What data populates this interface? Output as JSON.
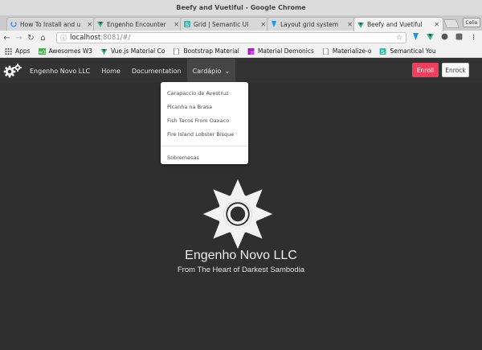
{
  "window": {
    "title": "Beefy and Vuetiful - Google Chrome"
  },
  "tabs": [
    {
      "label": "How To Install and u",
      "icon": "loading-icon"
    },
    {
      "label": "Engenho Encounter",
      "icon": "vue-icon"
    },
    {
      "label": "Grid | Semantic UI",
      "icon": "semantic-icon"
    },
    {
      "label": "Layout grid system",
      "icon": "vuetify-icon"
    },
    {
      "label": "Beefy and Vuetiful",
      "icon": "vue-icon"
    }
  ],
  "profile": {
    "label": "Celio"
  },
  "address": {
    "host": "localhost",
    "path": ":8081/#/"
  },
  "bookmarks": [
    {
      "label": "Apps",
      "icon": "apps-icon"
    },
    {
      "label": "Awesomes W3",
      "icon": "w3-icon"
    },
    {
      "label": "Vue.js Material Co",
      "icon": "vue-icon"
    },
    {
      "label": "Bootstrap Material",
      "icon": "page-icon"
    },
    {
      "label": "Material Demonics",
      "icon": "material-icon"
    },
    {
      "label": "Materialize-o",
      "icon": "page-icon"
    },
    {
      "label": "Semantical You",
      "icon": "semantic-icon"
    }
  ],
  "navbar": {
    "brand": "Engenho Novo LLC",
    "items": [
      "Home",
      "Documentation"
    ],
    "dropdown_label": "Cardápio",
    "enroll": "Enroll",
    "enrock": "Enrock"
  },
  "dropdown": {
    "items": [
      "Carapaccio de Avestruz",
      "Picanha na Brasa",
      "Fish Tacos From Oaxaco",
      "Fire Island Lobster Bisque"
    ],
    "extra": "Sobremesas"
  },
  "hero": {
    "title": "Engenho Novo LLC",
    "subtitle": "From The Heart of Darkest Sambodia"
  },
  "colors": {
    "page_bg": "#2f2f2f",
    "navbar_bg": "#333333",
    "enroll_bg": "#ee3f5d",
    "vue_green": "#41b883"
  }
}
